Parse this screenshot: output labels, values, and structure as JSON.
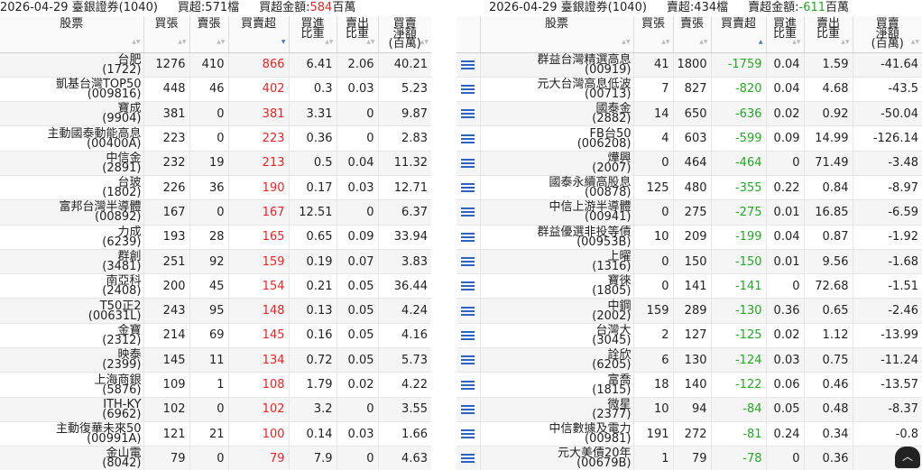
{
  "left": {
    "summary": {
      "date_broker": "2026-04-29 臺銀證券(1040)",
      "count_label": "買超:571檔",
      "amount_label": "買超金額:",
      "amount_value": "584",
      "amount_unit": "百萬",
      "amount_color": "#ee2222"
    },
    "columns": [
      {
        "l1": "股票",
        "l2": ""
      },
      {
        "l1": "買張",
        "l2": ""
      },
      {
        "l1": "賣張",
        "l2": ""
      },
      {
        "l1": "買賣超",
        "l2": ""
      },
      {
        "l1": "買進",
        "l2": "比重"
      },
      {
        "l1": "賣出",
        "l2": "比重"
      },
      {
        "l1": "買賣",
        "l2": "淨額",
        "l3": "(百萬)"
      }
    ],
    "rows": [
      {
        "name": "台肥",
        "code": "(1722)",
        "buy": "1276",
        "sell": "410",
        "net": "866",
        "buy_pct": "6.41",
        "sell_pct": "2.06",
        "amount": "40.21"
      },
      {
        "name": "凱基台灣TOP50",
        "code": "(009816)",
        "buy": "448",
        "sell": "46",
        "net": "402",
        "buy_pct": "0.3",
        "sell_pct": "0.03",
        "amount": "5.23"
      },
      {
        "name": "寶成",
        "code": "(9904)",
        "buy": "381",
        "sell": "0",
        "net": "381",
        "buy_pct": "3.31",
        "sell_pct": "0",
        "amount": "9.87"
      },
      {
        "name": "主動國泰動能高息",
        "code": "(00400A)",
        "buy": "223",
        "sell": "0",
        "net": "223",
        "buy_pct": "0.36",
        "sell_pct": "0",
        "amount": "2.83"
      },
      {
        "name": "中信金",
        "code": "(2891)",
        "buy": "232",
        "sell": "19",
        "net": "213",
        "buy_pct": "0.5",
        "sell_pct": "0.04",
        "amount": "11.32"
      },
      {
        "name": "台玻",
        "code": "(1802)",
        "buy": "226",
        "sell": "36",
        "net": "190",
        "buy_pct": "0.17",
        "sell_pct": "0.03",
        "amount": "12.71"
      },
      {
        "name": "富邦台灣半導體",
        "code": "(00892)",
        "buy": "167",
        "sell": "0",
        "net": "167",
        "buy_pct": "12.51",
        "sell_pct": "0",
        "amount": "6.37"
      },
      {
        "name": "力成",
        "code": "(6239)",
        "buy": "193",
        "sell": "28",
        "net": "165",
        "buy_pct": "0.65",
        "sell_pct": "0.09",
        "amount": "33.94"
      },
      {
        "name": "群創",
        "code": "(3481)",
        "buy": "251",
        "sell": "92",
        "net": "159",
        "buy_pct": "0.19",
        "sell_pct": "0.07",
        "amount": "3.83"
      },
      {
        "name": "南亞科",
        "code": "(2408)",
        "buy": "200",
        "sell": "45",
        "net": "154",
        "buy_pct": "0.21",
        "sell_pct": "0.05",
        "amount": "36.44"
      },
      {
        "name": "T50正2",
        "code": "(00631L)",
        "buy": "243",
        "sell": "95",
        "net": "148",
        "buy_pct": "0.13",
        "sell_pct": "0.05",
        "amount": "4.24"
      },
      {
        "name": "金寶",
        "code": "(2312)",
        "buy": "214",
        "sell": "69",
        "net": "145",
        "buy_pct": "0.16",
        "sell_pct": "0.05",
        "amount": "4.16"
      },
      {
        "name": "映泰",
        "code": "(2399)",
        "buy": "145",
        "sell": "11",
        "net": "134",
        "buy_pct": "0.72",
        "sell_pct": "0.05",
        "amount": "5.73"
      },
      {
        "name": "上海商銀",
        "code": "(5876)",
        "buy": "109",
        "sell": "1",
        "net": "108",
        "buy_pct": "1.79",
        "sell_pct": "0.02",
        "amount": "4.22"
      },
      {
        "name": "ITH-KY",
        "code": "(6962)",
        "buy": "102",
        "sell": "0",
        "net": "102",
        "buy_pct": "3.2",
        "sell_pct": "0",
        "amount": "3.55"
      },
      {
        "name": "主動復華未來50",
        "code": "(00991A)",
        "buy": "121",
        "sell": "21",
        "net": "100",
        "buy_pct": "0.14",
        "sell_pct": "0.03",
        "amount": "1.66"
      },
      {
        "name": "金山電",
        "code": "(8042)",
        "buy": "79",
        "sell": "0",
        "net": "79",
        "buy_pct": "7.9",
        "sell_pct": "0",
        "amount": "4.63"
      }
    ]
  },
  "right": {
    "summary": {
      "date_broker": "2026-04-29 臺銀證券(1040)",
      "count_label": "賣超:434檔",
      "amount_label": "賣超金額:",
      "amount_value": "-611",
      "amount_unit": "百萬",
      "amount_color": "#22aa22"
    },
    "columns": [
      {
        "l1": "",
        "l2": ""
      },
      {
        "l1": "股票",
        "l2": ""
      },
      {
        "l1": "買張",
        "l2": ""
      },
      {
        "l1": "賣張",
        "l2": ""
      },
      {
        "l1": "買賣超",
        "l2": ""
      },
      {
        "l1": "買進",
        "l2": "比重"
      },
      {
        "l1": "賣出",
        "l2": "比重"
      },
      {
        "l1": "買賣",
        "l2": "淨額",
        "l3": "(百萬)"
      }
    ],
    "rows": [
      {
        "name": "群益台灣精選高息",
        "code": "(00919)",
        "buy": "41",
        "sell": "1800",
        "net": "-1759",
        "buy_pct": "0.04",
        "sell_pct": "1.59",
        "amount": "-41.64"
      },
      {
        "name": "元大台灣高息低波",
        "code": "(00713)",
        "buy": "7",
        "sell": "827",
        "net": "-820",
        "buy_pct": "0.04",
        "sell_pct": "4.68",
        "amount": "-43.5"
      },
      {
        "name": "國泰金",
        "code": "(2882)",
        "buy": "14",
        "sell": "650",
        "net": "-636",
        "buy_pct": "0.02",
        "sell_pct": "0.92",
        "amount": "-50.04"
      },
      {
        "name": "FB台50",
        "code": "(006208)",
        "buy": "4",
        "sell": "603",
        "net": "-599",
        "buy_pct": "0.09",
        "sell_pct": "14.99",
        "amount": "-126.14"
      },
      {
        "name": "燁興",
        "code": "(2007)",
        "buy": "0",
        "sell": "464",
        "net": "-464",
        "buy_pct": "0",
        "sell_pct": "71.49",
        "amount": "-3.48"
      },
      {
        "name": "國泰永續高股息",
        "code": "(00878)",
        "buy": "125",
        "sell": "480",
        "net": "-355",
        "buy_pct": "0.22",
        "sell_pct": "0.84",
        "amount": "-8.97"
      },
      {
        "name": "中信上游半導體",
        "code": "(00941)",
        "buy": "0",
        "sell": "275",
        "net": "-275",
        "buy_pct": "0.01",
        "sell_pct": "16.85",
        "amount": "-6.59"
      },
      {
        "name": "群益優選非投等債",
        "code": "(00953B)",
        "buy": "10",
        "sell": "209",
        "net": "-199",
        "buy_pct": "0.04",
        "sell_pct": "0.87",
        "amount": "-1.92"
      },
      {
        "name": "上曜",
        "code": "(1316)",
        "buy": "0",
        "sell": "150",
        "net": "-150",
        "buy_pct": "0.01",
        "sell_pct": "9.56",
        "amount": "-1.68"
      },
      {
        "name": "寶徠",
        "code": "(1805)",
        "buy": "0",
        "sell": "141",
        "net": "-141",
        "buy_pct": "0",
        "sell_pct": "72.68",
        "amount": "-1.51"
      },
      {
        "name": "中鋼",
        "code": "(2002)",
        "buy": "159",
        "sell": "289",
        "net": "-130",
        "buy_pct": "0.36",
        "sell_pct": "0.65",
        "amount": "-2.46"
      },
      {
        "name": "台灣大",
        "code": "(3045)",
        "buy": "2",
        "sell": "127",
        "net": "-125",
        "buy_pct": "0.02",
        "sell_pct": "1.12",
        "amount": "-13.99"
      },
      {
        "name": "詮欣",
        "code": "(6205)",
        "buy": "6",
        "sell": "130",
        "net": "-124",
        "buy_pct": "0.03",
        "sell_pct": "0.75",
        "amount": "-11.24"
      },
      {
        "name": "富喬",
        "code": "(1815)",
        "buy": "18",
        "sell": "140",
        "net": "-122",
        "buy_pct": "0.06",
        "sell_pct": "0.46",
        "amount": "-13.57"
      },
      {
        "name": "微星",
        "code": "(2377)",
        "buy": "10",
        "sell": "94",
        "net": "-84",
        "buy_pct": "0.05",
        "sell_pct": "0.48",
        "amount": "-8.37"
      },
      {
        "name": "中信數據及電力",
        "code": "(00981)",
        "buy": "191",
        "sell": "272",
        "net": "-81",
        "buy_pct": "0.24",
        "sell_pct": "0.34",
        "amount": "-0.8"
      },
      {
        "name": "元大美債20年",
        "code": "(00679B)",
        "buy": "1",
        "sell": "79",
        "net": "-78",
        "buy_pct": "0",
        "sell_pct": "0.36",
        "amount": "-1"
      }
    ]
  },
  "icons": {
    "row_menu": "list-menu-icon",
    "scroll_top": "chevron-up-icon",
    "scroll_top_glyph": "︿"
  },
  "colors": {
    "positive": "#ee2222",
    "negative": "#22aa22",
    "menu_icon": "#2a63c4"
  }
}
